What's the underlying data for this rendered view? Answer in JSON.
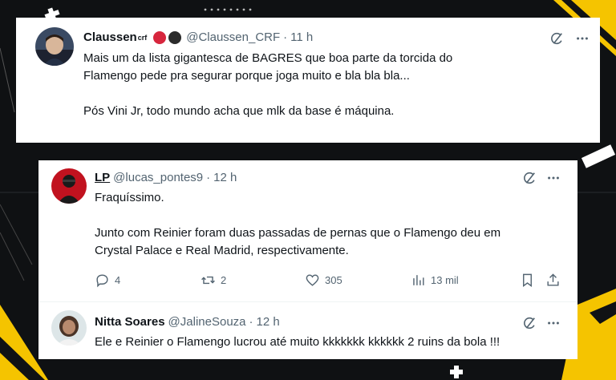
{
  "tweet_main": {
    "display_name": "Claussen",
    "name_suffix": "crf",
    "handle": "@Claussen_CRF",
    "separator": "·",
    "time": "11 h",
    "lines": [
      "Mais um da lista gigantesca de BAGRES que boa parte da torcida do",
      "Flamengo pede pra segurar porque joga muito e bla bla bla...",
      "Pós Vini Jr, todo mundo acha que mlk da base é máquina."
    ],
    "badge_colors": [
      "#d7263d",
      "#2b2b2b"
    ]
  },
  "reply_lp": {
    "display_name": "LP",
    "handle": "@lucas_pontes9",
    "separator": "·",
    "time": "12 h",
    "lines": [
      "Fraquíssimo.",
      "Junto com Reinier foram duas passadas de pernas que o Flamengo deu em",
      "Crystal Palace e Real Madrid, respectivamente."
    ],
    "metrics": {
      "replies": "4",
      "reposts": "2",
      "likes": "305",
      "views": "13 mil"
    }
  },
  "reply_nitta": {
    "display_name": "Nitta Soares",
    "handle": "@JalineSouza",
    "separator": "·",
    "time": "12 h",
    "text": "Ele e Reinier o Flamengo lucrou até muito kkkkkkk kkkkkk 2 ruins da bola !!!"
  },
  "colors": {
    "accent_yellow": "#f5c400",
    "text_primary": "#0f1419",
    "text_secondary": "#536471"
  },
  "icons": [
    "grok-icon",
    "more-icon",
    "reply-icon",
    "repost-icon",
    "like-icon",
    "views-icon",
    "bookmark-icon",
    "share-icon"
  ]
}
